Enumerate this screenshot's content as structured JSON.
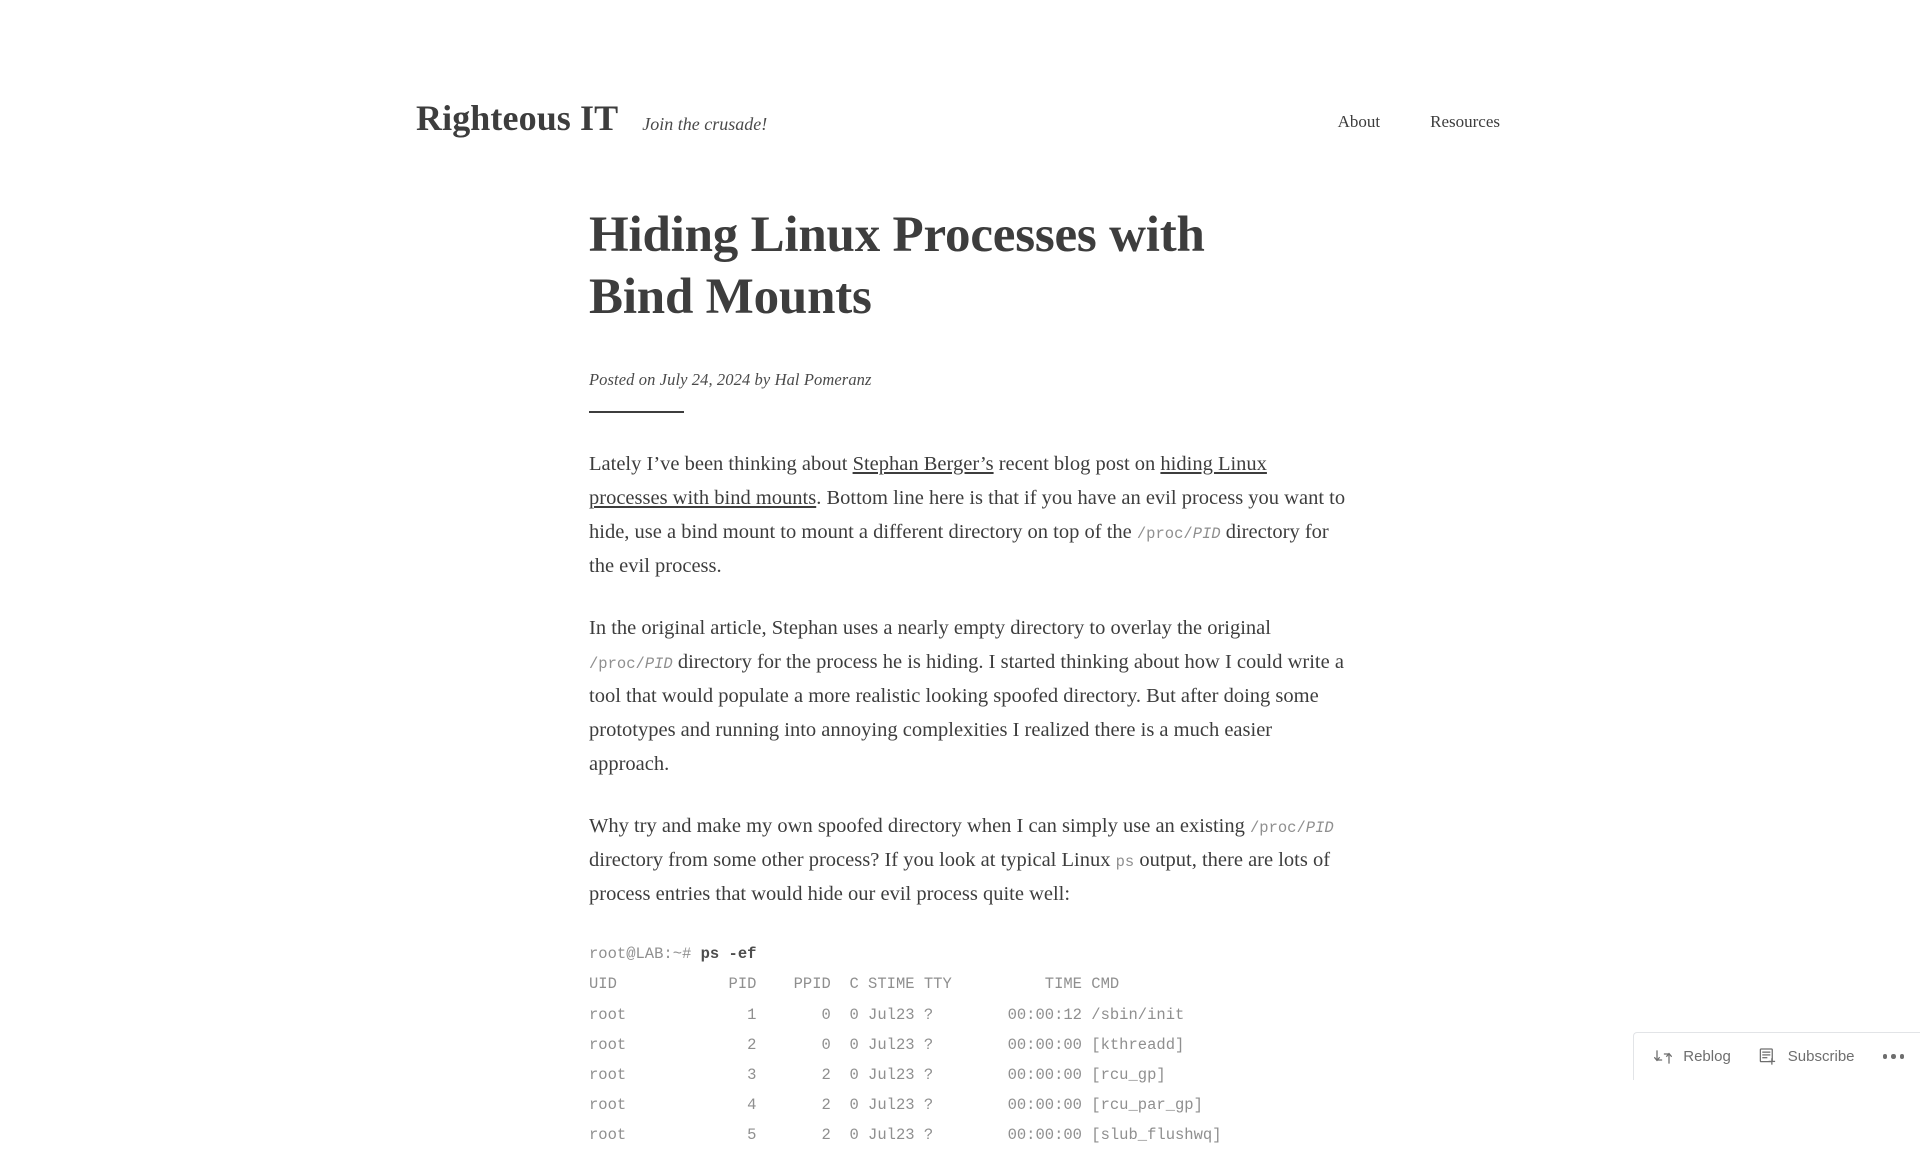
{
  "site": {
    "title": "Righteous IT",
    "tagline": "Join the crusade!",
    "background": "#ffffff",
    "text_color": "#3d3d3d"
  },
  "nav": {
    "items": [
      {
        "label": "About"
      },
      {
        "label": "Resources"
      }
    ]
  },
  "post": {
    "title": "Hiding Linux Processes with Bind Mounts",
    "meta": {
      "posted_on_prefix": "Posted on ",
      "date": "July 24, 2024",
      "by_text": " by ",
      "author": "Hal Pomeranz"
    },
    "paragraph1": {
      "a": "Lately I’ve been thinking about ",
      "link1": "Stephan Berger’s",
      "b": " recent blog post on ",
      "link2": "hiding Linux processes with bind mounts",
      "c": ". Bottom line here is that if you have an evil process you want to hide, use a bind mount to mount a different directory on top of the ",
      "code_prefix": "/proc/",
      "code_italic": "PID",
      "d": " directory for the evil process."
    },
    "paragraph2": {
      "a": "In the original article, Stephan uses a nearly empty directory to overlay the original ",
      "code_prefix": "/proc/",
      "code_italic": "PID",
      "b": " directory for the process he is hiding. I started thinking about how I could write a tool that would populate a more realistic looking spoofed directory. But after doing some prototypes and running into annoying complexities I realized there is a much easier approach."
    },
    "paragraph3": {
      "a": "Why try and make my own spoofed directory when I can simply use an existing ",
      "code_prefix": "/proc/",
      "code_italic": "PID",
      "b": " directory from some other process? If you look at typical Linux ",
      "code2": "ps",
      "c": " output, there are lots of process entries that would hide our evil process quite well:"
    },
    "code_block": {
      "prompt": "root@LAB:~# ",
      "command": "ps -ef",
      "lines": [
        "UID            PID    PPID  C STIME TTY          TIME CMD",
        "root             1       0  0 Jul23 ?        00:00:12 /sbin/init",
        "root             2       0  0 Jul23 ?        00:00:00 [kthreadd]",
        "root             3       2  0 Jul23 ?        00:00:00 [rcu_gp]",
        "root             4       2  0 Jul23 ?        00:00:00 [rcu_par_gp]",
        "root             5       2  0 Jul23 ?        00:00:00 [slub_flushwq]"
      ]
    }
  },
  "action_bar": {
    "reblog_label": "Reblog",
    "reblog_icon": "reblog-icon",
    "subscribe_label": "Subscribe",
    "subscribe_icon": "subscribe-icon",
    "more_icon": "ellipsis-icon"
  }
}
